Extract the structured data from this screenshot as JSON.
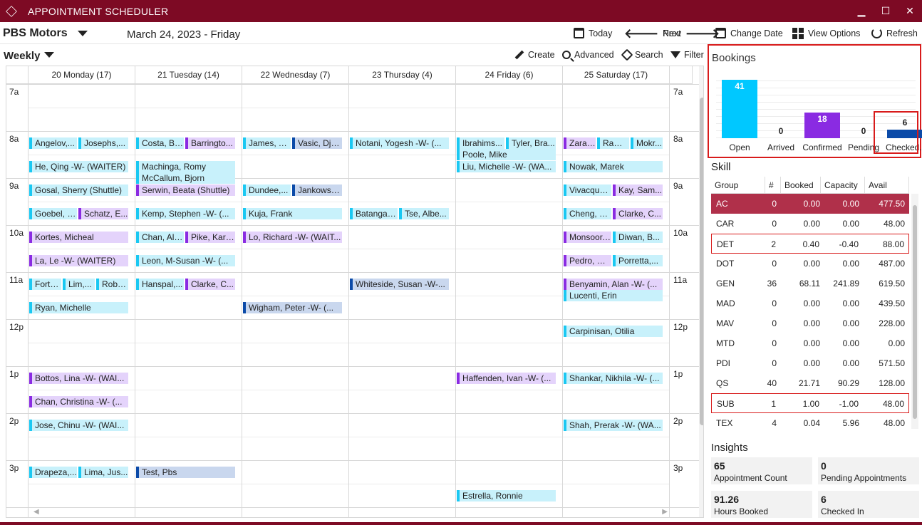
{
  "window": {
    "title": "APPOINTMENT SCHEDULER",
    "min": "▁",
    "max": "☐",
    "close": "✕"
  },
  "header": {
    "dealer": "PBS Motors",
    "date": "March 24, 2023 - Friday"
  },
  "toolbar": {
    "today": "Today",
    "prev": "Prev",
    "next": "Next",
    "change_date": "Change Date",
    "view_options": "View Options",
    "refresh": "Refresh"
  },
  "view": {
    "mode": "Weekly",
    "create": "Create",
    "advanced": "Advanced",
    "search": "Search",
    "filter": "Filter"
  },
  "days": [
    "20 Monday (17)",
    "21 Tuesday (14)",
    "22 Wednesday (7)",
    "23 Thursday (4)",
    "24 Friday (6)",
    "25 Saturday (17)"
  ],
  "times": [
    "7a",
    "8a",
    "9a",
    "10a",
    "11a",
    "12p",
    "1p",
    "2p",
    "3p"
  ],
  "appointments": [
    {
      "day": 0,
      "slot": 2,
      "sub": 0,
      "part": 0,
      "name": "Angelov,...",
      "status": "arrived"
    },
    {
      "day": 0,
      "slot": 2,
      "sub": 0,
      "part": 1,
      "name": "Josephs,...",
      "status": "arrived"
    },
    {
      "day": 0,
      "slot": 3,
      "sub": 0,
      "part": -1,
      "name": "He, Qing -W- (WAITER)",
      "status": "arrived"
    },
    {
      "day": 0,
      "slot": 4,
      "sub": 0,
      "part": -1,
      "name": "Gosal, Sherry (Shuttle)",
      "status": "arrived"
    },
    {
      "day": 0,
      "slot": 5,
      "sub": 0,
      "part": 0,
      "name": "Goebel, P...",
      "status": "arrived"
    },
    {
      "day": 0,
      "slot": 5,
      "sub": 0,
      "part": 1,
      "name": "Schatz, E...",
      "status": "confirmed"
    },
    {
      "day": 0,
      "slot": 6,
      "sub": 0,
      "part": -1,
      "name": "Kortes, Micheal",
      "status": "confirmed"
    },
    {
      "day": 0,
      "slot": 7,
      "sub": 0,
      "part": -1,
      "name": "La, Le -W- (WAITER)",
      "status": "confirmed"
    },
    {
      "day": 0,
      "slot": 8,
      "sub": 0,
      "part": 10,
      "name": "Forta...",
      "status": "arrived"
    },
    {
      "day": 0,
      "slot": 8,
      "sub": 0,
      "part": 11,
      "name": "Lim,...",
      "status": "arrived"
    },
    {
      "day": 0,
      "slot": 8,
      "sub": 0,
      "part": 12,
      "name": "Robe...",
      "status": "arrived"
    },
    {
      "day": 0,
      "slot": 9,
      "sub": 0,
      "part": -1,
      "name": "Ryan, Michelle",
      "status": "arrived"
    },
    {
      "day": 0,
      "slot": 12,
      "sub": 0,
      "part": -1,
      "name": "Bottos, Lina -W- (WAI...",
      "status": "confirmed"
    },
    {
      "day": 0,
      "slot": 13,
      "sub": 0,
      "part": -1,
      "name": "Chan, Christina -W- (...",
      "status": "confirmed"
    },
    {
      "day": 0,
      "slot": 14,
      "sub": 0,
      "part": -1,
      "name": "Jose, Chinu -W- (WAI...",
      "status": "arrived"
    },
    {
      "day": 0,
      "slot": 16,
      "sub": 0,
      "part": 0,
      "name": "Drapeza,...",
      "status": "arrived"
    },
    {
      "day": 0,
      "slot": 16,
      "sub": 0,
      "part": 1,
      "name": "Lima, Jus...",
      "status": "arrived"
    },
    {
      "day": 1,
      "slot": 2,
      "sub": 0,
      "part": 0,
      "name": "Costa, Bri...",
      "status": "arrived"
    },
    {
      "day": 1,
      "slot": 2,
      "sub": 0,
      "part": 1,
      "name": "Barringto...",
      "status": "confirmed"
    },
    {
      "day": 1,
      "slot": 3,
      "sub": 0,
      "part": -1,
      "name": "Machinga, Romy",
      "status": "arrived"
    },
    {
      "day": 1,
      "slot": 3,
      "sub": 1,
      "part": -1,
      "name": "McCallum, Bjorn",
      "status": "arrived"
    },
    {
      "day": 1,
      "slot": 4,
      "sub": 0,
      "part": -1,
      "name": "Serwin, Beata (Shuttle)",
      "status": "confirmed"
    },
    {
      "day": 1,
      "slot": 5,
      "sub": 0,
      "part": -1,
      "name": "Kemp, Stephen -W- (...",
      "status": "arrived"
    },
    {
      "day": 1,
      "slot": 6,
      "sub": 0,
      "part": 0,
      "name": "Chan, Alvis",
      "status": "arrived"
    },
    {
      "day": 1,
      "slot": 6,
      "sub": 0,
      "part": 1,
      "name": "Pike, Karen",
      "status": "confirmed"
    },
    {
      "day": 1,
      "slot": 7,
      "sub": 0,
      "part": -1,
      "name": "Leon, M-Susan -W- (...",
      "status": "arrived"
    },
    {
      "day": 1,
      "slot": 8,
      "sub": 0,
      "part": 0,
      "name": "Hanspal,...",
      "status": "arrived"
    },
    {
      "day": 1,
      "slot": 8,
      "sub": 0,
      "part": 1,
      "name": "Clarke, C...",
      "status": "confirmed"
    },
    {
      "day": 1,
      "slot": 16,
      "sub": 0,
      "part": -1,
      "name": "Test, Pbs",
      "status": "checked"
    },
    {
      "day": 2,
      "slot": 2,
      "sub": 0,
      "part": 0,
      "name": "James, To...",
      "status": "arrived"
    },
    {
      "day": 2,
      "slot": 2,
      "sub": 0,
      "part": 1,
      "name": "Vasic, Djo...",
      "status": "checked"
    },
    {
      "day": 2,
      "slot": 4,
      "sub": 0,
      "part": 0,
      "name": "Dundee,...",
      "status": "arrived"
    },
    {
      "day": 2,
      "slot": 4,
      "sub": 0,
      "part": 1,
      "name": "Jankowsk...",
      "status": "checked"
    },
    {
      "day": 2,
      "slot": 5,
      "sub": 0,
      "part": -1,
      "name": "Kuja, Frank",
      "status": "arrived"
    },
    {
      "day": 2,
      "slot": 6,
      "sub": 0,
      "part": -1,
      "name": "Lo, Richard -W- (WAIT...",
      "status": "confirmed"
    },
    {
      "day": 2,
      "slot": 9,
      "sub": 0,
      "part": -1,
      "name": "Wigham, Peter -W- (...",
      "status": "checked"
    },
    {
      "day": 3,
      "slot": 2,
      "sub": 0,
      "part": -1,
      "name": "Notani, Yogesh -W- (...",
      "status": "arrived"
    },
    {
      "day": 3,
      "slot": 5,
      "sub": 0,
      "part": 0,
      "name": "Batangan...",
      "status": "arrived"
    },
    {
      "day": 3,
      "slot": 5,
      "sub": 0,
      "part": 1,
      "name": "Tse, Albe...",
      "status": "arrived"
    },
    {
      "day": 3,
      "slot": 8,
      "sub": 0,
      "part": -1,
      "name": "Whiteside, Susan -W-...",
      "status": "checked"
    },
    {
      "day": 4,
      "slot": 2,
      "sub": 0,
      "part": 0,
      "name": "Ibrahims...",
      "status": "arrived"
    },
    {
      "day": 4,
      "slot": 2,
      "sub": 0,
      "part": 1,
      "name": "Tyler, Bra...",
      "status": "arrived"
    },
    {
      "day": 4,
      "slot": 2,
      "sub": 1,
      "part": -1,
      "name": "Poole, Mike",
      "status": "arrived"
    },
    {
      "day": 4,
      "slot": 3,
      "sub": 0,
      "part": -1,
      "name": "Liu, Michelle -W- (WA...",
      "status": "arrived"
    },
    {
      "day": 4,
      "slot": 12,
      "sub": 0,
      "part": -1,
      "name": "Haffenden, Ivan -W- (...",
      "status": "confirmed"
    },
    {
      "day": 4,
      "slot": 17,
      "sub": 0,
      "part": -1,
      "name": "Estrella, Ronnie",
      "status": "arrived"
    },
    {
      "day": 5,
      "slot": 2,
      "sub": 0,
      "part": 10,
      "name": "Zarat...",
      "status": "confirmed"
    },
    {
      "day": 5,
      "slot": 2,
      "sub": 0,
      "part": 11,
      "name": "Rams...",
      "status": "arrived"
    },
    {
      "day": 5,
      "slot": 2,
      "sub": 0,
      "part": 12,
      "name": "Mokr...",
      "status": "arrived"
    },
    {
      "day": 5,
      "slot": 3,
      "sub": 0,
      "part": -1,
      "name": "Nowak, Marek",
      "status": "arrived"
    },
    {
      "day": 5,
      "slot": 4,
      "sub": 0,
      "part": 0,
      "name": "Vivacqua,...",
      "status": "arrived"
    },
    {
      "day": 5,
      "slot": 4,
      "sub": 0,
      "part": 1,
      "name": "Kay, Sam...",
      "status": "confirmed"
    },
    {
      "day": 5,
      "slot": 5,
      "sub": 0,
      "part": 0,
      "name": "Cheng, E...",
      "status": "arrived"
    },
    {
      "day": 5,
      "slot": 5,
      "sub": 0,
      "part": 1,
      "name": "Clarke, C...",
      "status": "confirmed"
    },
    {
      "day": 5,
      "slot": 6,
      "sub": 0,
      "part": 0,
      "name": "Monsoor,...",
      "status": "confirmed"
    },
    {
      "day": 5,
      "slot": 6,
      "sub": 0,
      "part": 1,
      "name": "Diwan, B...",
      "status": "arrived"
    },
    {
      "day": 5,
      "slot": 7,
      "sub": 0,
      "part": 0,
      "name": "Pedro, Ca...",
      "status": "confirmed"
    },
    {
      "day": 5,
      "slot": 7,
      "sub": 0,
      "part": 1,
      "name": "Porretta,...",
      "status": "arrived"
    },
    {
      "day": 5,
      "slot": 8,
      "sub": 0,
      "part": -1,
      "name": "Benyamin, Alan -W- (...",
      "status": "confirmed"
    },
    {
      "day": 5,
      "slot": 8,
      "sub": 1,
      "part": -1,
      "name": "Lucenti, Erin",
      "status": "arrived"
    },
    {
      "day": 5,
      "slot": 10,
      "sub": 0,
      "part": -1,
      "name": "Carpinisan, Otilia",
      "status": "arrived"
    },
    {
      "day": 5,
      "slot": 12,
      "sub": 0,
      "part": -1,
      "name": "Shankar, Nikhila -W- (...",
      "status": "arrived"
    },
    {
      "day": 5,
      "slot": 14,
      "sub": 0,
      "part": -1,
      "name": "Shah, Prerak -W- (WA...",
      "status": "arrived"
    }
  ],
  "bookings": {
    "title": "Bookings",
    "items": [
      {
        "label": "Open",
        "value": 41,
        "color": "#00c8ff"
      },
      {
        "label": "Arrived",
        "value": 0,
        "color": "#00c8ff"
      },
      {
        "label": "Confirmed",
        "value": 18,
        "color": "#8a2be2"
      },
      {
        "label": "Pending",
        "value": 0,
        "color": "#00c8ff"
      },
      {
        "label": "Checked..",
        "value": 6,
        "color": "#0b4aa8"
      }
    ]
  },
  "skill": {
    "title": "Skill",
    "headers": [
      "Group",
      "#",
      "Booked",
      "Capacity",
      "Avail"
    ],
    "rows": [
      {
        "group": "AC",
        "num": "0",
        "booked": "0.00",
        "capacity": "0.00",
        "avail": "477.50",
        "selected": true
      },
      {
        "group": "CAR",
        "num": "0",
        "booked": "0.00",
        "capacity": "0.00",
        "avail": "48.00"
      },
      {
        "group": "DET",
        "num": "2",
        "booked": "0.40",
        "capacity": "-0.40",
        "avail": "88.00",
        "highlight": true
      },
      {
        "group": "DOT",
        "num": "0",
        "booked": "0.00",
        "capacity": "0.00",
        "avail": "487.00"
      },
      {
        "group": "GEN",
        "num": "36",
        "booked": "68.11",
        "capacity": "241.89",
        "avail": "619.50"
      },
      {
        "group": "MAD",
        "num": "0",
        "booked": "0.00",
        "capacity": "0.00",
        "avail": "439.50"
      },
      {
        "group": "MAV",
        "num": "0",
        "booked": "0.00",
        "capacity": "0.00",
        "avail": "228.00"
      },
      {
        "group": "MTD",
        "num": "0",
        "booked": "0.00",
        "capacity": "0.00",
        "avail": "0.00"
      },
      {
        "group": "PDI",
        "num": "0",
        "booked": "0.00",
        "capacity": "0.00",
        "avail": "571.50"
      },
      {
        "group": "QS",
        "num": "40",
        "booked": "21.71",
        "capacity": "90.29",
        "avail": "128.00"
      },
      {
        "group": "SUB",
        "num": "1",
        "booked": "1.00",
        "capacity": "-1.00",
        "avail": "48.00",
        "highlight": true
      },
      {
        "group": "TEX",
        "num": "4",
        "booked": "0.04",
        "capacity": "5.96",
        "avail": "48.00"
      }
    ]
  },
  "insights": {
    "title": "Insights",
    "cards": [
      {
        "value": "65",
        "label": "Appointment Count"
      },
      {
        "value": "0",
        "label": "Pending Appointments"
      },
      {
        "value": "91.26",
        "label": "Hours Booked"
      },
      {
        "value": "6",
        "label": "Checked In"
      }
    ]
  }
}
